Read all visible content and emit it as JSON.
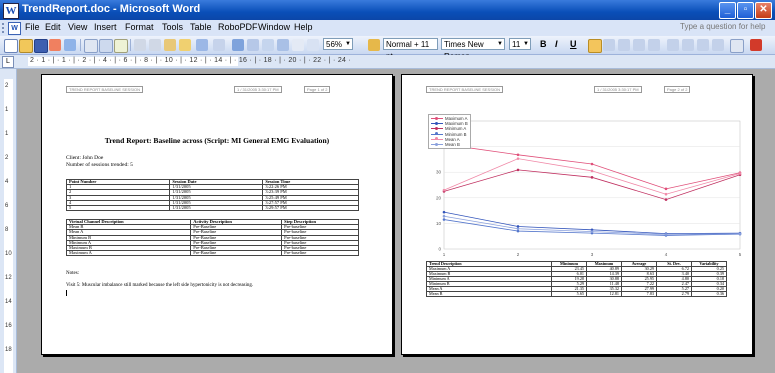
{
  "window": {
    "title": "TrendReport.doc - Microsoft Word",
    "app_badge": "W"
  },
  "menu": {
    "items": [
      {
        "label": "File",
        "key": "F"
      },
      {
        "label": "Edit",
        "key": "E"
      },
      {
        "label": "View",
        "key": "V"
      },
      {
        "label": "Insert",
        "key": "I"
      },
      {
        "label": "Format",
        "key": "o"
      },
      {
        "label": "Tools",
        "key": "T"
      },
      {
        "label": "Table",
        "key": "a"
      },
      {
        "label": "RoboPDF",
        "key": "R"
      },
      {
        "label": "Window",
        "key": "W"
      },
      {
        "label": "Help",
        "key": "H"
      }
    ],
    "help_placeholder": "Type a question for help"
  },
  "toolbar": {
    "zoom": "56%",
    "style": "Normal + 11 pt",
    "font": "Times New Roman",
    "size": "11",
    "bold": "B",
    "italic": "I",
    "underline": "U"
  },
  "ruler": {
    "labels": "2 · 1 · | · 1 · | · 2 · | · 4 · | · 6 · | · 8 · | · 10 · | · 12 · | · 14 · | · 16 · | · 18 · | · 20 · | · 22 · | · 24 ·",
    "vlabels": [
      "2",
      "1",
      "1",
      "2",
      "4",
      "6",
      "8",
      "10",
      "12",
      "14",
      "16",
      "18"
    ]
  },
  "page1": {
    "header_left": "TREND REPORT BASELINE SESSION",
    "header_mid": "1 / 31/2005 3:30:17 PM",
    "header_right": "Page 1 of 2",
    "title": "Trend Report: Baseline across (Script: MI General EMG Evaluation)",
    "client": "Client: John Doe",
    "sessions": "Number of sessions trended: 5",
    "sessions_table": {
      "headers": [
        "Point Number",
        "Session Date",
        "Session Time"
      ],
      "rows": [
        [
          "1",
          "1/31/2005",
          "3:22:26 PM"
        ],
        [
          "2",
          "1/31/2005",
          "3:23:39 PM"
        ],
        [
          "3",
          "1/31/2005",
          "3:25:49 PM"
        ],
        [
          "4",
          "1/31/2005",
          "3:27:57 PM"
        ],
        [
          "5",
          "1/31/2005",
          "3:29:57 PM"
        ]
      ]
    },
    "channel_table": {
      "headers": [
        "Virtual Channel Description",
        "Activity Description",
        "Step Description"
      ],
      "rows": [
        [
          "Mean B",
          "Pre-Baseline",
          "Pre-baseline"
        ],
        [
          "Mean A",
          "Pre-Baseline",
          "Pre-baseline"
        ],
        [
          "Minimum B",
          "Pre-Baseline",
          "Pre-baseline"
        ],
        [
          "Minimum A",
          "Pre-Baseline",
          "Pre-baseline"
        ],
        [
          "Maximum B",
          "Pre-Baseline",
          "Pre-baseline"
        ],
        [
          "Maximum A",
          "Pre-Baseline",
          "Pre-baseline"
        ]
      ]
    },
    "notes_label": "Notes:",
    "note": "Visit 5: Muscular imbalance still marked because the left side hypertonicity is not decreasing."
  },
  "page2": {
    "header_left": "TREND REPORT BASELINE SESSION",
    "header_mid": "1 / 31/2005 3:30:17 PM",
    "header_right": "Page 2 of 2",
    "stats_table": {
      "headers": [
        "Trend Description",
        "Minimum",
        "Maximum",
        "Average",
        "St. Dev.",
        "Variability"
      ],
      "rows": [
        [
          "Maximum A",
          "23.45",
          "40.89",
          "30.29",
          "6.72",
          "0.25"
        ],
        [
          "Maximum B",
          "6.01",
          "14.39",
          "8.63",
          "3.40",
          "0.39"
        ],
        [
          "Minimum A",
          "19.28",
          "30.88",
          "25.95",
          "4.80",
          "0.18"
        ],
        [
          "Minimum B",
          "5.29",
          "11.48",
          "7.22",
          "2.47",
          "0.34"
        ],
        [
          "Mean A",
          "21.35",
          "35.32",
          "27.99",
          "5.27",
          "0.20"
        ],
        [
          "Mean B",
          "5.65",
          "12.81",
          "7.83",
          "2.79",
          "0.36"
        ]
      ]
    }
  },
  "chart_data": {
    "type": "line",
    "x": [
      1,
      2,
      3,
      4,
      5
    ],
    "ylim": [
      0,
      50
    ],
    "yticks": [
      0,
      10,
      20,
      30,
      40
    ],
    "xticks": [
      1,
      2,
      3,
      4,
      5
    ],
    "legend_position": "top-left",
    "series": [
      {
        "name": "Maximum A",
        "color": "#e0507a",
        "values": [
          40.9,
          36.8,
          33.2,
          23.5,
          29.8
        ]
      },
      {
        "name": "Maximum B",
        "color": "#3355bb",
        "values": [
          14.4,
          8.8,
          7.5,
          6.0,
          6.2
        ]
      },
      {
        "name": "Minimum A",
        "color": "#c03060",
        "values": [
          22.5,
          30.9,
          28.0,
          19.3,
          29.0
        ]
      },
      {
        "name": "Minimum B",
        "color": "#5577cc",
        "values": [
          11.5,
          7.0,
          6.2,
          5.3,
          5.8
        ]
      },
      {
        "name": "Mean A",
        "color": "#f08aa8",
        "values": [
          23.0,
          35.3,
          30.5,
          21.4,
          29.5
        ]
      },
      {
        "name": "Mean B",
        "color": "#8aa0dd",
        "values": [
          12.8,
          7.9,
          6.8,
          5.7,
          6.0
        ]
      }
    ]
  }
}
